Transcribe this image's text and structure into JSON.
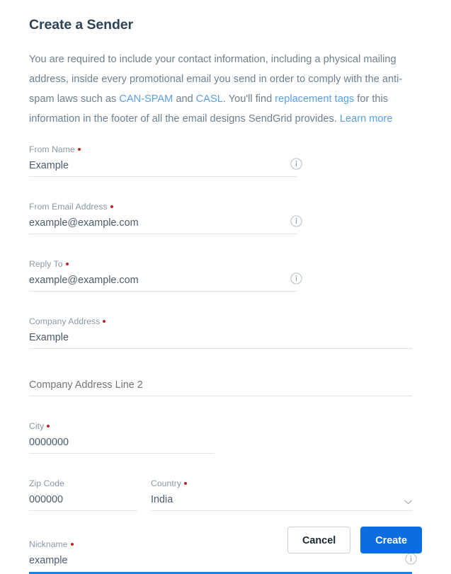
{
  "page": {
    "title": "Create a Sender"
  },
  "intro": {
    "seg1": "You are required to include your contact information, including a physical mailing address, inside every promotional email you send in order to comply with the anti-spam laws such as ",
    "link_canspam": "CAN-SPAM",
    "seg2": " and ",
    "link_casl": "CASL",
    "seg3": ". You'll find ",
    "link_replacement_tags": "replacement tags",
    "seg4": " for this information in the footer of all the email designs SendGrid provides. ",
    "link_learn_more": "Learn more"
  },
  "form": {
    "from_name": {
      "label": "From Name",
      "required": true,
      "value": "Example",
      "info_icon": "info-circle-icon"
    },
    "from_email": {
      "label": "From Email Address",
      "required": true,
      "value": "example@example.com",
      "info_icon": "info-circle-icon"
    },
    "reply_to": {
      "label": "Reply To",
      "required": true,
      "value": "example@example.com",
      "info_icon": "info-circle-icon"
    },
    "company_address": {
      "label": "Company Address",
      "required": true,
      "value": "Example"
    },
    "company_address_2": {
      "label": "",
      "required": false,
      "value": "",
      "placeholder": "Company Address Line 2"
    },
    "city": {
      "label": "City",
      "required": true,
      "value": "0000000"
    },
    "zip_code": {
      "label": "Zip Code",
      "required": false,
      "value": "000000"
    },
    "country": {
      "label": "Country",
      "required": true,
      "value": "India",
      "chevron_icon": "chevron-down-icon"
    },
    "nickname": {
      "label": "Nickname",
      "required": true,
      "value": "example",
      "focused": true,
      "info_icon": "info-circle-icon"
    }
  },
  "footer": {
    "cancel_label": "Cancel",
    "create_label": "Create"
  },
  "colors": {
    "title": "#2e4356",
    "body_text": "#70808f",
    "link": "#5aa0ea",
    "label": "#8a98a6",
    "value": "#4c5c6d",
    "required_dot": "#b52626",
    "field_underline": "#dfe3e8",
    "focus_underline": "#1a82e2",
    "primary_button": "#0a6ee0",
    "cancel_border": "#c9d1d9",
    "cancel_text": "#1b2733"
  }
}
